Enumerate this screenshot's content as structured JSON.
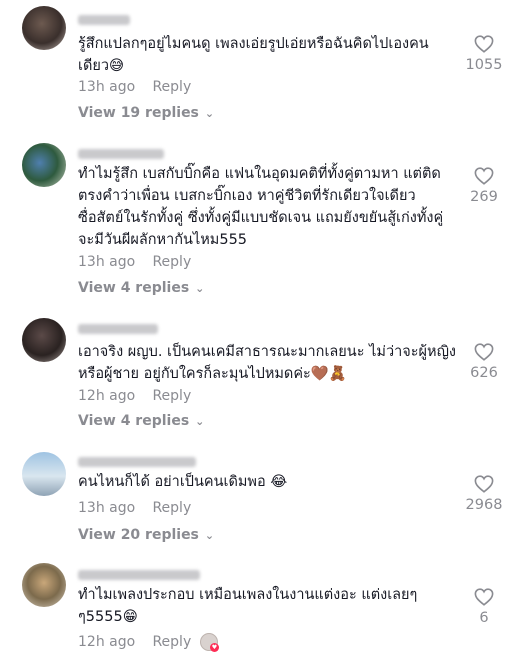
{
  "comments": [
    {
      "username": "",
      "text": "รู้สึกแปลกๆอยู่ไมคนดู เพลงเอ่ยรูปเอ่ยหรือฉันคิดไปเองคนเดียว😅",
      "time": "13h ago",
      "reply_label": "Reply",
      "likes": "1055",
      "view_replies": "View 19 replies"
    },
    {
      "username": "",
      "text": "ทำไมรู้สึก เบสกับบิ๊กคือ แฟนในอุดมคติที่ทั้งคู่ตามหา แต่ติดตรงคำว่าเพื่อน เบสกะบิ๊กเอง หาคู่ชีวิตที่รักเดียวใจเดียว ซื่อสัตย์ในรักทั้งคู่ ซึ่งทั้งคู่มีแบบชัดเจน แถมยังขยันสู้เก่งทั้งคู่ จะมีวันผีผลักหากันไหม555",
      "time": "13h ago",
      "reply_label": "Reply",
      "likes": "269",
      "view_replies": "View 4 replies"
    },
    {
      "username": "",
      "text": "เอาจริง ผญบ. เป็นคนเคมีสาธารณะมากเลยนะ ไม่ว่าจะผู้หญิงหรือผู้ชาย อยู่กับใครก็ละมุนไปหมดค่ะ🤎🧸",
      "time": "12h ago",
      "reply_label": "Reply",
      "likes": "626",
      "view_replies": "View 4 replies"
    },
    {
      "username": "",
      "text": "คนไหนก็ได้ อย่าเป็นคนเดิมพอ 😂",
      "time": "13h ago",
      "reply_label": "Reply",
      "likes": "2968",
      "view_replies": "View 20 replies"
    },
    {
      "username": "",
      "text": "ทำไมเพลงประกอบ เหมือนเพลงในงานแต่งอะ แต่งเลยๆ ๆ5555😁",
      "time": "12h ago",
      "reply_label": "Reply",
      "likes": "6",
      "view_replies": ""
    }
  ],
  "colors": {
    "text": "#161823",
    "muted": "#8a8b91",
    "heart_outline": "#8a8b91",
    "creator_badge": "#fe2c55"
  },
  "icons": {
    "like": "heart-outline-icon",
    "expand": "chevron-down-icon",
    "creator_liked": "creator-liked-icon"
  }
}
